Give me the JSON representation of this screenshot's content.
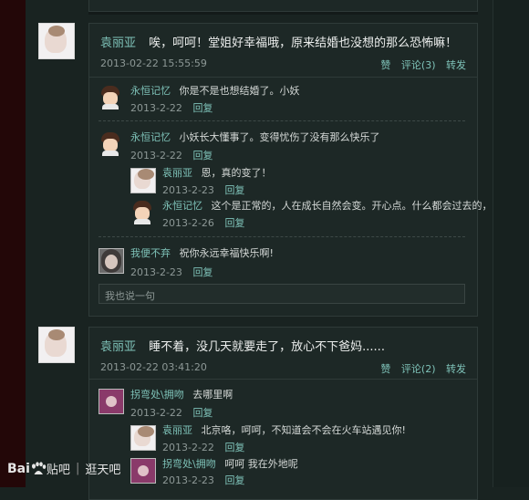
{
  "post1": {
    "author": "袁丽亚",
    "text": "唉，呵呵！堂姐好幸福哦，原来结婚也没想的那么恐怖嘛！",
    "date": "2013-02-22 15:55:59",
    "actions": [
      "赞",
      "评论(3)",
      "转发"
    ],
    "replies": [
      {
        "name": "永恒记忆",
        "text": "你是不是也想结婚了。小妖",
        "date": "2013-2-22",
        "reply": "回复"
      },
      {
        "name": "永恒记忆",
        "text": "小妖长大懂事了。变得忧伤了没有那么快乐了",
        "date": "2013-2-22",
        "reply": "回复"
      },
      {
        "name": "袁丽亚",
        "text": "恩，真的变了！",
        "date": "2013-2-23",
        "reply": "回复"
      },
      {
        "name": "永恒记忆",
        "text": "这个是正常的，人在成长自然会变。开心点。什么都会过去的，",
        "date": "2013-2-26",
        "reply": "回复"
      },
      {
        "name": "我便不弃",
        "text": "祝你永远幸福快乐啊!",
        "date": "2013-2-23",
        "reply": "回复"
      }
    ],
    "input_placeholder": "我也说一句"
  },
  "post2": {
    "author": "袁丽亚",
    "text": "睡不着，没几天就要走了，放心不下爸妈......",
    "date": "2013-02-22 03:41:20",
    "actions": [
      "赞",
      "评论(2)",
      "转发"
    ],
    "replies": [
      {
        "name": "拐弯处\\拥吻",
        "text": "去哪里啊",
        "date": "2013-2-22",
        "reply": "回复"
      },
      {
        "name": "袁丽亚",
        "text": "北京咯，呵呵，不知道会不会在火车站遇见你!",
        "date": "2013-2-22",
        "reply": "回复"
      },
      {
        "name": "拐弯处\\拥吻",
        "text": "呵呵 我在外地呢",
        "date": "2013-2-23",
        "reply": "回复"
      }
    ]
  },
  "watermark": {
    "brand_bai": "Bai",
    "brand_rest": "贴吧",
    "divider": "|",
    "tag": "逛天吧"
  }
}
